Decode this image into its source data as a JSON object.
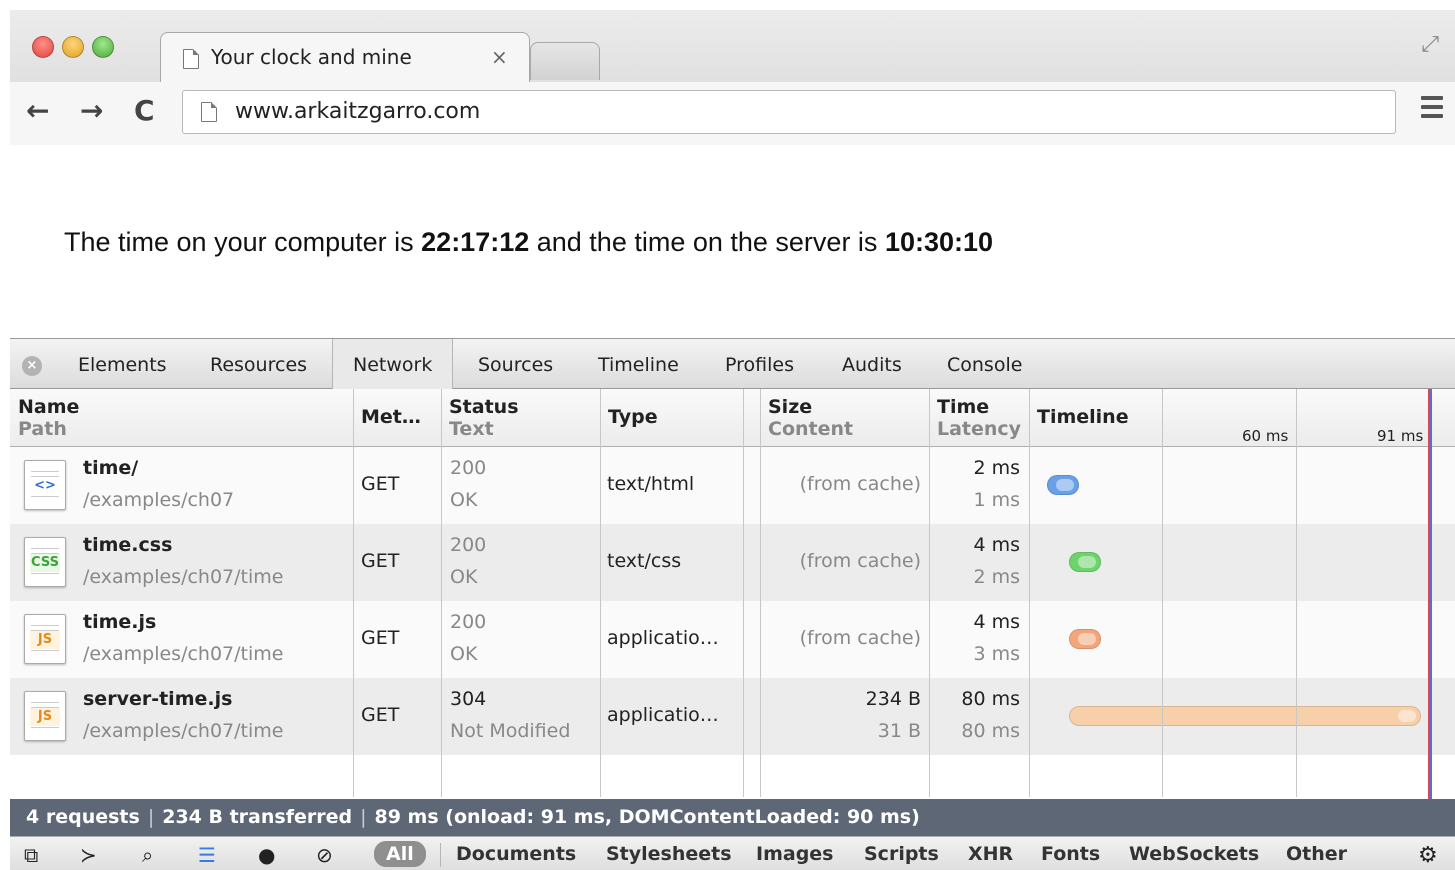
{
  "browser": {
    "tab_title": "Your clock and mine",
    "tab_close": "×",
    "url": "www.arkaitzgarro.com",
    "nav": {
      "back": "←",
      "forward": "→",
      "reload": "C"
    }
  },
  "page": {
    "prefix": "The time on your computer is ",
    "client_time": "22:17:12",
    "middle": " and the time on the server is ",
    "server_time": "10:30:10"
  },
  "devtools": {
    "close": "×",
    "tabs": [
      "Elements",
      "Resources",
      "Network",
      "Sources",
      "Timeline",
      "Profiles",
      "Audits",
      "Console"
    ],
    "active_tab": "Network",
    "columns": {
      "name": "Name",
      "path": "Path",
      "method": "Met…",
      "status": "Status",
      "text": "Text",
      "type": "Type",
      "size": "Size",
      "content": "Content",
      "time": "Time",
      "latency": "Latency",
      "timeline": "Timeline",
      "tick1": "60 ms",
      "tick2": "91 ms"
    },
    "rows": [
      {
        "name": "time/",
        "path": "/examples/ch07",
        "icon": "html",
        "badge": "<>",
        "method": "GET",
        "status": "200",
        "text": "OK",
        "type": "text/html",
        "size": "(from cache)",
        "content": "",
        "time": "2 ms",
        "latency": "1 ms",
        "bar_color": "#6aa0e8",
        "bar_start_ms": 0,
        "bar_end_ms": 2
      },
      {
        "name": "time.css",
        "path": "/examples/ch07/time",
        "icon": "css",
        "badge": "CSS",
        "method": "GET",
        "status": "200",
        "text": "OK",
        "type": "text/css",
        "size": "(from cache)",
        "content": "",
        "time": "4 ms",
        "latency": "2 ms",
        "bar_color": "#6cd46c",
        "bar_start_ms": 5,
        "bar_end_ms": 9
      },
      {
        "name": "time.js",
        "path": "/examples/ch07/time",
        "icon": "js",
        "badge": "JS",
        "method": "GET",
        "status": "200",
        "text": "OK",
        "type": "applicatio…",
        "size": "(from cache)",
        "content": "",
        "time": "4 ms",
        "latency": "3 ms",
        "bar_color": "#f2a77a",
        "bar_start_ms": 5,
        "bar_end_ms": 9
      },
      {
        "name": "server-time.js",
        "path": "/examples/ch07/time",
        "icon": "js",
        "badge": "JS",
        "method": "GET",
        "status": "304",
        "text": "Not Modified",
        "type": "applicatio…",
        "size": "234 B",
        "content": "31 B",
        "time": "80 ms",
        "latency": "80 ms",
        "bar_color": "#f7cfa8",
        "bar_start_ms": 5,
        "bar_end_ms": 85
      }
    ],
    "timeline_max_ms": 91,
    "summary": {
      "requests": "4 requests",
      "transferred": "234 B transferred",
      "timing": "89 ms (onload: 91 ms, DOMContentLoaded: 90 ms)",
      "sep": "|"
    },
    "filters": [
      "All",
      "Documents",
      "Stylesheets",
      "Images",
      "Scripts",
      "XHR",
      "Fonts",
      "WebSockets",
      "Other"
    ],
    "active_filter": "All",
    "colors": {
      "summary_bg": "#5e6776",
      "onload_line": "#d94b4b",
      "domcontent_line": "#5a6cdc"
    }
  }
}
